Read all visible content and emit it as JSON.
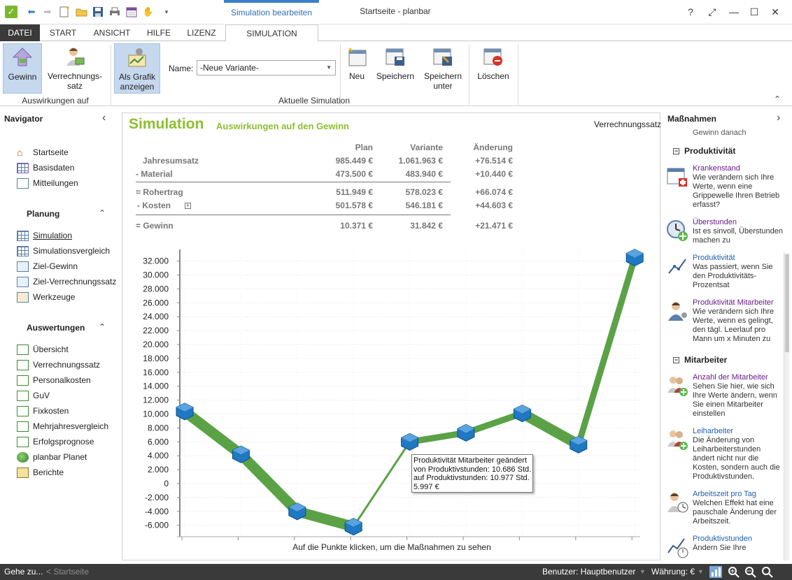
{
  "window": {
    "contextual_tab": "Simulation bearbeiten",
    "title": "Startseite - planbar",
    "controls": [
      "?",
      "⤢",
      "—",
      "☐",
      "✕"
    ]
  },
  "ribbon_tabs": [
    "DATEI",
    "START",
    "ANSICHT",
    "HILFE",
    "LIZENZ",
    "SIMULATION"
  ],
  "ribbon": {
    "gewinn": "Gewinn",
    "verrechnungssatz_l1": "Verrechnungs-",
    "verrechnungssatz_l2": "satz",
    "group1_label": "Auswirkungen auf",
    "als_grafik_l1": "Als Grafik",
    "als_grafik_l2": "anzeigen",
    "name_label": "Name:",
    "name_value": "-Neue Variante-",
    "neu": "Neu",
    "speichern": "Speichern",
    "speichern_unter_l1": "Speichern",
    "speichern_unter_l2": "unter",
    "loeschen": "Löschen",
    "group2_label": "Aktuelle Simulation"
  },
  "navigator": {
    "title": "Navigator",
    "top_items": [
      "Startseite",
      "Basisdaten",
      "Mitteilungen"
    ],
    "planung_title": "Planung",
    "planung_items": [
      "Simulation",
      "Simulationsvergleich",
      "Ziel-Gewinn",
      "Ziel-Verrechnungssatz",
      "Werkzeuge"
    ],
    "auswertungen_title": "Auswertungen",
    "auswertungen_items": [
      "Übersicht",
      "Verrechnungssatz",
      "Personalkosten",
      "GuV",
      "Fixkosten",
      "Mehrjahresvergleich",
      "Erfolgsprognose",
      "planbar Planet",
      "Berichte"
    ]
  },
  "main": {
    "title": "Simulation",
    "subtitle": "Auswirkungen auf den Gewinn",
    "link": "Verrechnungssatz",
    "columns": [
      "Plan",
      "Variante",
      "Änderung"
    ],
    "rows": [
      {
        "label": "Jahresumsatz",
        "plan": "985.449 €",
        "variante": "1.061.963 €",
        "aenderung": "+76.514 €"
      },
      {
        "label": "-  Material",
        "plan": "473.500 €",
        "variante": "483.940 €",
        "aenderung": "+10.440 €"
      },
      {
        "label": "= Rohertrag",
        "plan": "511.949 €",
        "variante": "578.023 €",
        "aenderung": "+66.074 €"
      },
      {
        "label": "-  Kosten",
        "plan": "501.578 €",
        "variante": "546.181 €",
        "aenderung": "+44.603 €"
      },
      {
        "label": "= Gewinn",
        "plan": "10.371 €",
        "variante": "31.842 €",
        "aenderung": "+21.471 €"
      }
    ],
    "chart_hint": "Auf die Punkte klicken, um die Maßnahmen zu sehen"
  },
  "tooltip": {
    "line1": "Produktivität Mitarbeiter geändert",
    "line2": "von Produktivstunden: 10.686 Std.",
    "line3": "auf Produktivstunden: 10.977 Std.",
    "line4": "5.997 €"
  },
  "chart_data": {
    "type": "line",
    "ylim": [
      -7000,
      33000
    ],
    "y_ticks": [
      "32.000",
      "30.000",
      "28.000",
      "26.000",
      "24.000",
      "22.000",
      "20.000",
      "18.000",
      "16.000",
      "14.000",
      "12.000",
      "10.000",
      "8.000",
      "6.000",
      "4.000",
      "2.000",
      "0",
      "-2.000",
      "-4.000",
      "-6.000"
    ],
    "y_tick_values": [
      32000,
      30000,
      28000,
      26000,
      24000,
      22000,
      20000,
      18000,
      16000,
      14000,
      12000,
      10000,
      8000,
      6000,
      4000,
      2000,
      0,
      -2000,
      -4000,
      -6000
    ],
    "x": [
      1,
      2,
      3,
      4,
      5,
      6,
      7,
      8,
      9
    ],
    "series": [
      {
        "values": [
          10371,
          4200,
          -4000,
          -6200,
          5997,
          7300,
          10100,
          5600,
          32500
        ]
      }
    ],
    "grid": true,
    "colors": {
      "line": "#5aa245",
      "marker": "#1f78c1"
    }
  },
  "right_panel": {
    "title": "Maßnahmen",
    "gewinn_danach": "Gewinn danach",
    "sec_produktivitaet": "Produktivität",
    "sec_mitarbeiter": "Mitarbeiter",
    "items": [
      {
        "link": "Krankenstand",
        "desc": "Wie verändern sich Ihre Werte, wenn eine Grippewelle Ihren Betrieb erfasst?"
      },
      {
        "link": "Überstunden",
        "desc": "Ist es sinvoll, Überstunden machen zu"
      },
      {
        "link": "Produktivität",
        "desc": "Was passiert, wenn Sie den Produktivitäts-Prozentsat"
      },
      {
        "link": "Produktivität Mitarbeiter",
        "desc": "Wie verändern sich Ihre Werte,  wenn es gelingt, den tägl. Leerlauf pro Mann um x Minuten zu"
      },
      {
        "link": "Anzahl der Mitarbeiter",
        "desc": "Sehen Sie hier, wie sich Ihre Werte ändern, wenn Sie einen Mitarbeiter einstellen"
      },
      {
        "link": "Leiharbeiter",
        "desc": "Die Änderung von Leiharbeiterstunden ändert nicht nur die Kosten, sondern auch die Produktivstunden."
      },
      {
        "link": "Arbeitszeit pro Tag",
        "desc": "Welchen Effekt hat eine pauschale Änderung der Arbeitszeit."
      },
      {
        "link": "Produktivstunden",
        "desc": "Ändern Sie Ihre Produktivstunden durch"
      }
    ]
  },
  "status": {
    "gehe_zu": "Gehe zu...",
    "breadcrumb": "< Startseite",
    "benutzer": "Benutzer: Hauptbenutzer",
    "waehrung": "Währung: €"
  }
}
